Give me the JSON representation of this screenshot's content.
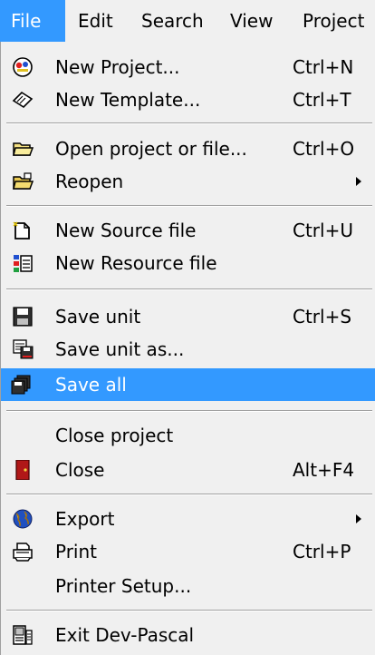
{
  "menubar": {
    "items": [
      {
        "label": "File",
        "active": true
      },
      {
        "label": "Edit"
      },
      {
        "label": "Search"
      },
      {
        "label": "View"
      },
      {
        "label": "Project"
      }
    ]
  },
  "menu": {
    "new_project": {
      "label": "New Project...",
      "shortcut": "Ctrl+N"
    },
    "new_template": {
      "label": "New Template...",
      "shortcut": "Ctrl+T"
    },
    "open": {
      "label": "Open project or file...",
      "shortcut": "Ctrl+O"
    },
    "reopen": {
      "label": "Reopen"
    },
    "new_source": {
      "label": "New Source file",
      "shortcut": "Ctrl+U"
    },
    "new_resource": {
      "label": "New Resource file"
    },
    "save_unit": {
      "label": "Save unit",
      "shortcut": "Ctrl+S"
    },
    "save_unit_as": {
      "label": "Save unit as..."
    },
    "save_all": {
      "label": "Save all"
    },
    "close_project": {
      "label": "Close project"
    },
    "close": {
      "label": "Close",
      "shortcut": "Alt+F4"
    },
    "export": {
      "label": "Export"
    },
    "print": {
      "label": "Print",
      "shortcut": "Ctrl+P"
    },
    "printer_setup": {
      "label": "Printer Setup..."
    },
    "exit": {
      "label": "Exit Dev-Pascal"
    }
  },
  "colors": {
    "highlight": "#3399ff",
    "menu_bg": "#f0f0f0"
  }
}
